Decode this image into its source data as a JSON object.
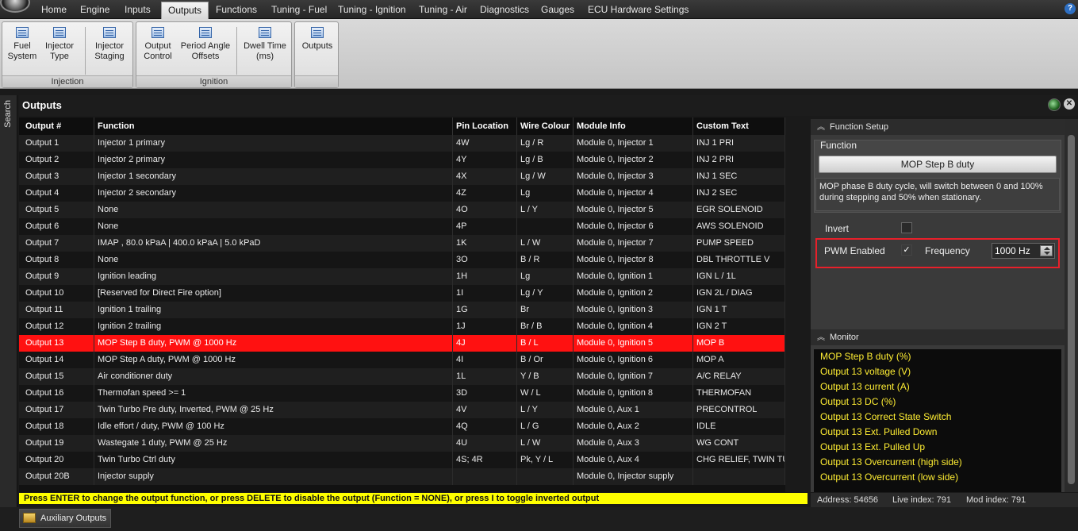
{
  "menu": {
    "items": [
      {
        "label": "Home",
        "left": 0
      },
      {
        "label": "Engine"
      },
      {
        "label": "Inputs"
      },
      {
        "label": "Outputs"
      },
      {
        "label": "Functions"
      },
      {
        "label": "Tuning - Fuel"
      },
      {
        "label": "Tuning - Ignition"
      },
      {
        "label": "Tuning - Air"
      },
      {
        "label": "Diagnostics"
      },
      {
        "label": "Gauges"
      },
      {
        "label": "ECU Hardware Settings"
      }
    ],
    "active": "Outputs",
    "help": "?"
  },
  "ribbon": {
    "injection": {
      "label": "Injection",
      "buttons": [
        "Fuel\nSystem",
        "Injector\nType",
        "Injector\nStaging"
      ]
    },
    "ignition": {
      "label": "Ignition",
      "buttons": [
        "Output\nControl",
        "Period Angle\nOffsets",
        "Dwell Time\n(ms)"
      ]
    },
    "outputs": {
      "buttons": [
        "Outputs"
      ]
    }
  },
  "search_tab": "Search",
  "panel_title": "Outputs",
  "table": {
    "headers": [
      "Output #",
      "Function",
      "Pin Location",
      "Wire Colour",
      "Module Info",
      "Custom Text"
    ],
    "rows": [
      [
        "Output 1",
        "Injector 1 primary",
        "4W",
        "Lg / R",
        "Module 0, Injector 1",
        "INJ 1 PRI"
      ],
      [
        "Output 2",
        "Injector 2 primary",
        "4Y",
        "Lg / B",
        "Module 0, Injector 2",
        "INJ 2 PRI"
      ],
      [
        "Output 3",
        "Injector 1 secondary",
        "4X",
        "Lg / W",
        "Module 0, Injector 3",
        "INJ 1 SEC"
      ],
      [
        "Output 4",
        "Injector 2 secondary",
        "4Z",
        "Lg",
        "Module 0, Injector 4",
        "INJ 2 SEC"
      ],
      [
        "Output 5",
        "None",
        "4O",
        "L / Y",
        "Module 0, Injector 5",
        "EGR SOLENOID"
      ],
      [
        "Output 6",
        "None",
        "4P",
        "",
        "Module 0, Injector 6",
        "AWS SOLENOID"
      ],
      [
        "Output 7",
        "IMAP , 80.0 kPaA | 400.0 kPaA | 5.0 kPaD",
        "1K",
        "L / W",
        "Module 0, Injector 7",
        "PUMP SPEED"
      ],
      [
        "Output 8",
        "None",
        "3O",
        "B / R",
        "Module 0, Injector 8",
        "DBL THROTTLE V"
      ],
      [
        "Output 9",
        "Ignition leading",
        "1H",
        "Lg",
        "Module 0, Ignition 1",
        "IGN L / 1L"
      ],
      [
        "Output 10",
        "[Reserved for Direct Fire option]",
        "1I",
        "Lg / Y",
        "Module 0, Ignition 2",
        "IGN 2L / DIAG"
      ],
      [
        "Output 11",
        "Ignition 1 trailing",
        "1G",
        "Br",
        "Module 0, Ignition 3",
        "IGN 1 T"
      ],
      [
        "Output 12",
        "Ignition 2 trailing",
        "1J",
        "Br / B",
        "Module 0, Ignition 4",
        "IGN 2 T"
      ],
      [
        "Output 13",
        "MOP Step B duty, PWM @ 1000 Hz",
        "4J",
        "B / L",
        "Module 0, Ignition 5",
        "MOP B"
      ],
      [
        "Output 14",
        "MOP Step A duty, PWM @ 1000 Hz",
        "4I",
        "B / Or",
        "Module 0, Ignition 6",
        "MOP A"
      ],
      [
        "Output 15",
        "Air conditioner duty",
        "1L",
        "Y / B",
        "Module 0, Ignition 7",
        "A/C RELAY"
      ],
      [
        "Output 16",
        "Thermofan speed >= 1",
        "3D",
        "W / L",
        "Module 0, Ignition 8",
        "THERMOFAN"
      ],
      [
        "Output 17",
        "Twin Turbo Pre duty, Inverted, PWM @ 25 Hz",
        "4V",
        "L / Y",
        "Module 0, Aux 1",
        "PRECONTROL"
      ],
      [
        "Output 18",
        "Idle effort / duty, PWM @ 100 Hz",
        "4Q",
        "L / G",
        "Module 0, Aux 2",
        "IDLE"
      ],
      [
        "Output 19",
        "Wastegate 1 duty, PWM @ 25 Hz",
        "4U",
        "L / W",
        "Module 0, Aux 3",
        "WG CONT"
      ],
      [
        "Output 20",
        "Twin Turbo Ctrl duty",
        "4S; 4R",
        "Pk, Y / L",
        "Module 0, Aux 4",
        "CHG RELIEF, TWIN TURBO"
      ],
      [
        "Output 20B",
        "Injector supply",
        "",
        "",
        "Module 0, Injector supply",
        ""
      ]
    ],
    "selected_index": 12
  },
  "status_message": "Press ENTER to change the output function, or press DELETE to disable the output (Function = NONE), or press I to toggle inverted output",
  "function_setup": {
    "header": "Function Setup",
    "function_label": "Function",
    "function_value": "MOP Step B duty",
    "description": "MOP phase B duty cycle, will switch between 0 and 100% during stepping and 50% when stationary.",
    "invert_label": "Invert",
    "invert_checked": false,
    "pwm_label": "PWM Enabled",
    "pwm_checked": true,
    "pwm_check_glyph": "✓",
    "frequency_label": "Frequency",
    "frequency_value": "1000 Hz",
    "highlight_color": "#e8202a"
  },
  "monitor": {
    "header": "Monitor",
    "items": [
      "MOP Step B duty (%)",
      "Output 13 voltage (V)",
      "Output 13 current (A)",
      "Output 13  DC (%)",
      "Output 13 Correct State Switch",
      "Output 13 Ext. Pulled Down",
      "Output 13 Ext. Pulled Up",
      "Output 13  Overcurrent (high side)",
      "Output 13  Overcurrent (low side)"
    ],
    "text_color": "#ffee33"
  },
  "info_bar": {
    "address": "Address: 54656",
    "live_index": "Live index: 791",
    "mod_index": "Mod index: 791"
  },
  "bottom_tab": "Auxiliary Outputs",
  "colors": {
    "selected_row": "#ff1111",
    "status_bar": "#ffff00"
  }
}
